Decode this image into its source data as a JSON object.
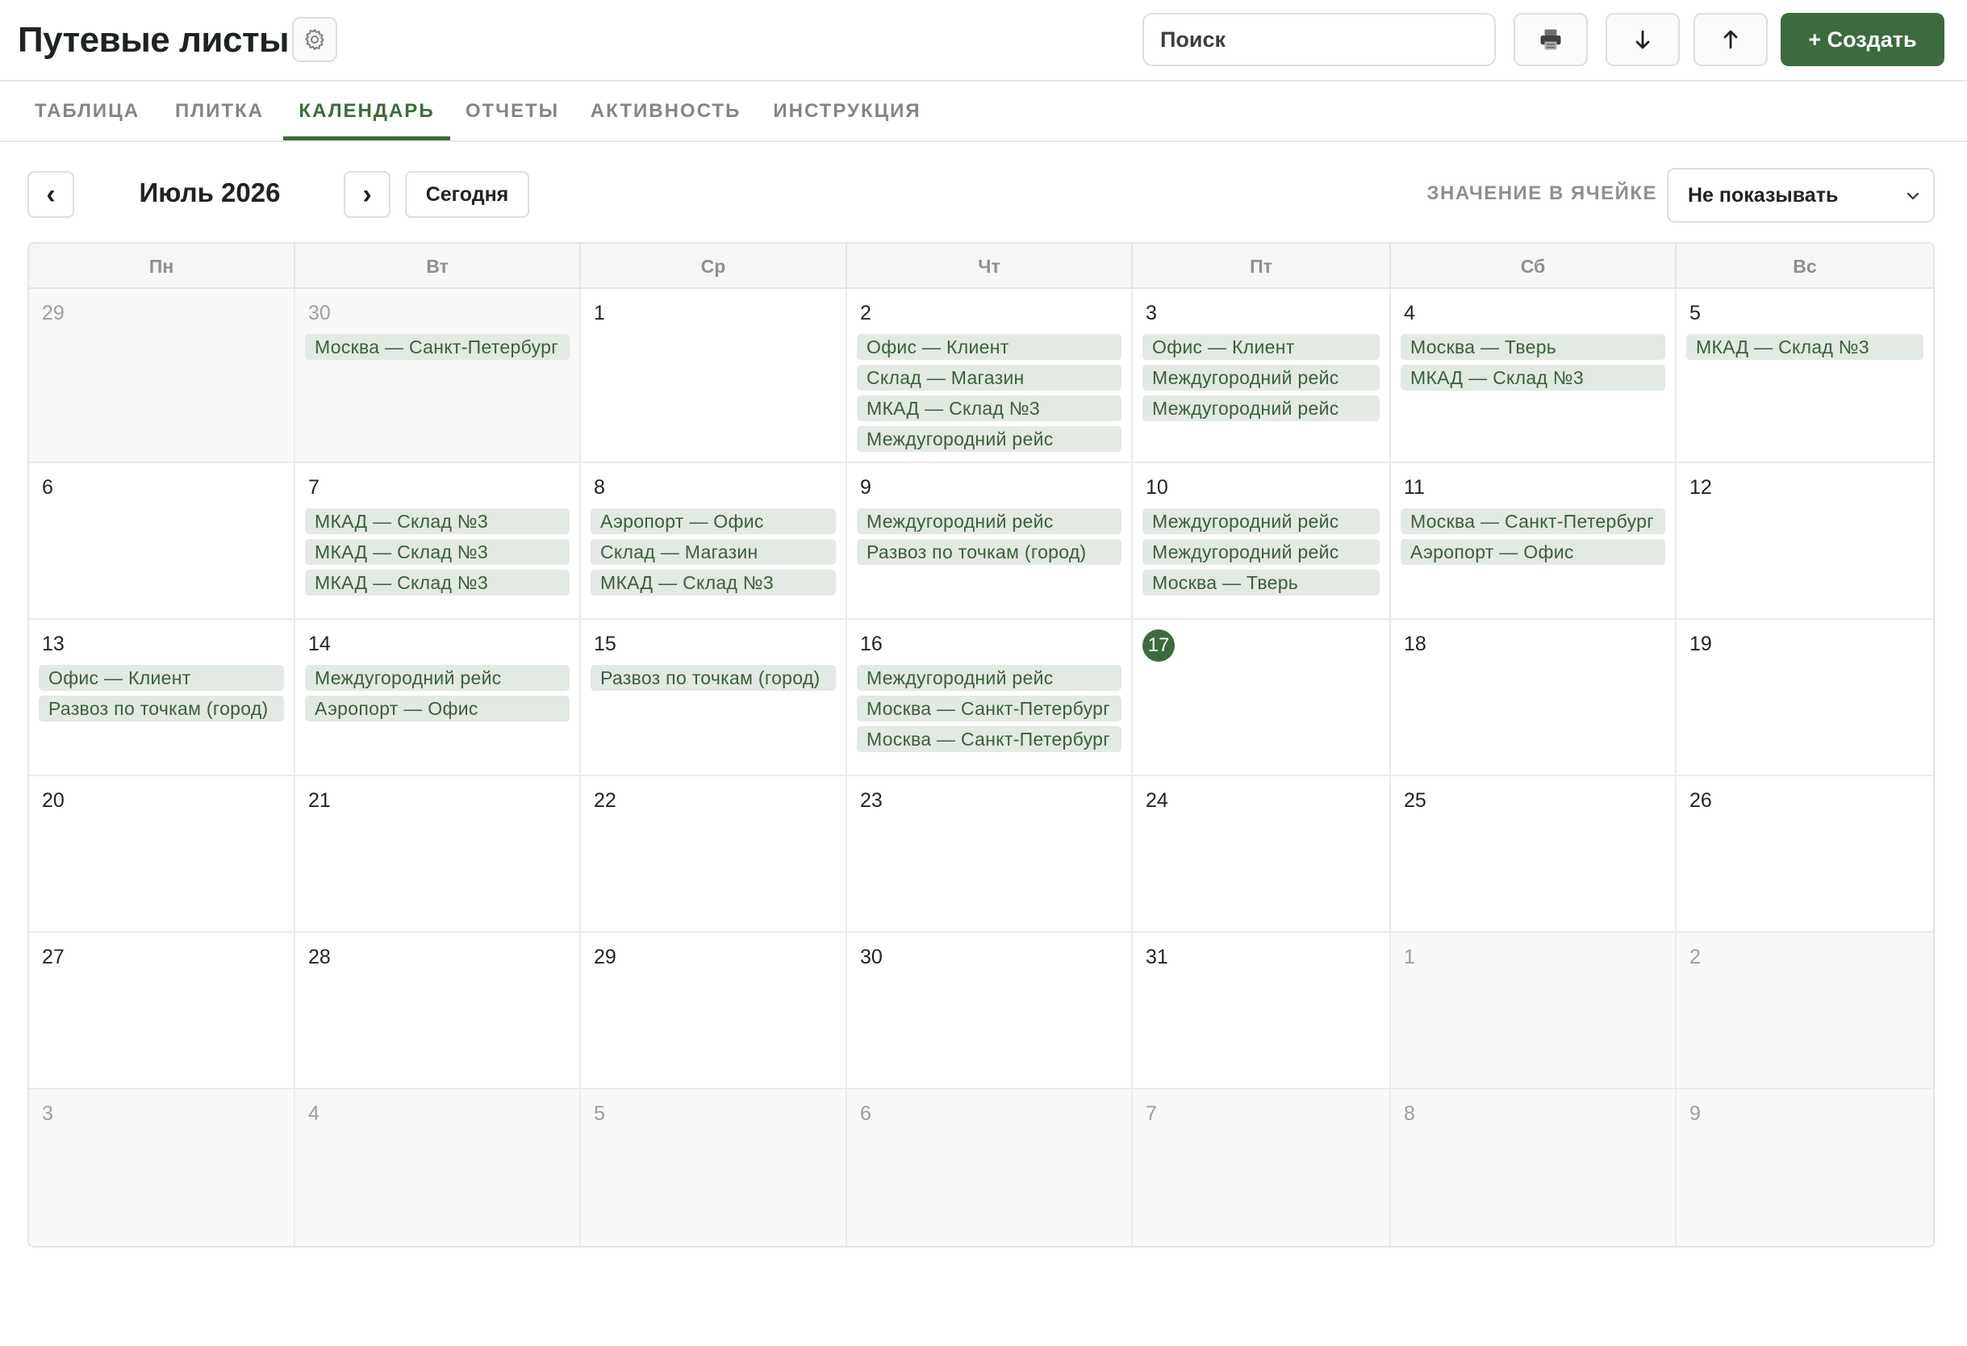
{
  "header": {
    "title": "Путевые листы",
    "search_placeholder": "Поиск",
    "create_label": "+ Создать",
    "icons": [
      "gear-icon",
      "printer-icon",
      "arrow-down-icon",
      "arrow-up-icon"
    ]
  },
  "tabs": [
    {
      "label": "ТАБЛИЦА",
      "active": false
    },
    {
      "label": "ПЛИТКА",
      "active": false
    },
    {
      "label": "КАЛЕНДАРЬ",
      "active": true
    },
    {
      "label": "ОТЧЕТЫ",
      "active": false
    },
    {
      "label": "АКТИВНОСТЬ",
      "active": false
    },
    {
      "label": "ИНСТРУКЦИЯ",
      "active": false
    }
  ],
  "toolbar": {
    "prev_label": "‹",
    "next_label": "›",
    "month_label": "Июль 2026",
    "today_label": "Сегодня",
    "cell_value_label": "ЗНАЧЕНИЕ В ЯЧЕЙКЕ",
    "cell_value_selected": "Не показывать"
  },
  "colors": {
    "accent": "#3c6b3d",
    "event_bg": "#e3e9e3",
    "event_text": "#3a5f3c"
  },
  "calendar": {
    "weekdays": [
      "Пн",
      "Вт",
      "Ср",
      "Чт",
      "Пт",
      "Сб",
      "Вс"
    ],
    "weeks": [
      [
        {
          "day": "29",
          "other": true,
          "events": []
        },
        {
          "day": "30",
          "other": true,
          "events": [
            "Москва — Санкт-Петербург"
          ]
        },
        {
          "day": "1",
          "events": []
        },
        {
          "day": "2",
          "events": [
            "Офис — Клиент",
            "Склад — Магазин",
            "МКАД — Склад №3",
            "Междугородний рейс"
          ]
        },
        {
          "day": "3",
          "events": [
            "Офис — Клиент",
            "Междугородний рейс",
            "Междугородний рейс"
          ]
        },
        {
          "day": "4",
          "events": [
            "Москва — Тверь",
            "МКАД — Склад №3"
          ]
        },
        {
          "day": "5",
          "events": [
            "МКАД — Склад №3"
          ]
        }
      ],
      [
        {
          "day": "6",
          "events": []
        },
        {
          "day": "7",
          "events": [
            "МКАД — Склад №3",
            "МКАД — Склад №3",
            "МКАД — Склад №3"
          ]
        },
        {
          "day": "8",
          "events": [
            "Аэропорт — Офис",
            "Склад — Магазин",
            "МКАД — Склад №3"
          ]
        },
        {
          "day": "9",
          "events": [
            "Междугородний рейс",
            "Развоз по точкам (город)"
          ]
        },
        {
          "day": "10",
          "events": [
            "Междугородний рейс",
            "Междугородний рейс",
            "Москва — Тверь"
          ]
        },
        {
          "day": "11",
          "events": [
            "Москва — Санкт-Петербург",
            "Аэропорт — Офис"
          ]
        },
        {
          "day": "12",
          "events": []
        }
      ],
      [
        {
          "day": "13",
          "events": [
            "Офис — Клиент",
            "Развоз по точкам (город)"
          ]
        },
        {
          "day": "14",
          "events": [
            "Междугородний рейс",
            "Аэропорт — Офис"
          ]
        },
        {
          "day": "15",
          "events": [
            "Развоз по точкам (город)"
          ]
        },
        {
          "day": "16",
          "events": [
            "Междугородний рейс",
            "Москва — Санкт-Петербург",
            "Москва — Санкт-Петербург"
          ]
        },
        {
          "day": "17",
          "today": true,
          "events": []
        },
        {
          "day": "18",
          "events": []
        },
        {
          "day": "19",
          "events": []
        }
      ],
      [
        {
          "day": "20",
          "events": []
        },
        {
          "day": "21",
          "events": []
        },
        {
          "day": "22",
          "events": []
        },
        {
          "day": "23",
          "events": []
        },
        {
          "day": "24",
          "events": []
        },
        {
          "day": "25",
          "events": []
        },
        {
          "day": "26",
          "events": []
        }
      ],
      [
        {
          "day": "27",
          "events": []
        },
        {
          "day": "28",
          "events": []
        },
        {
          "day": "29",
          "events": []
        },
        {
          "day": "30",
          "events": []
        },
        {
          "day": "31",
          "events": []
        },
        {
          "day": "1",
          "other": true,
          "events": []
        },
        {
          "day": "2",
          "other": true,
          "events": []
        }
      ],
      [
        {
          "day": "3",
          "other": true,
          "events": []
        },
        {
          "day": "4",
          "other": true,
          "events": []
        },
        {
          "day": "5",
          "other": true,
          "events": []
        },
        {
          "day": "6",
          "other": true,
          "events": []
        },
        {
          "day": "7",
          "other": true,
          "events": []
        },
        {
          "day": "8",
          "other": true,
          "events": []
        },
        {
          "day": "9",
          "other": true,
          "events": []
        }
      ]
    ]
  }
}
